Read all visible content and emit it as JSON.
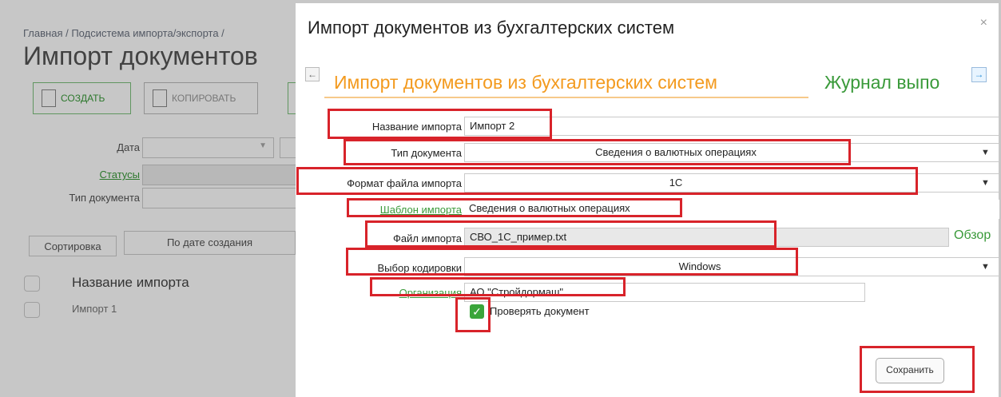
{
  "background": {
    "breadcrumb": "Главная  /  Подсистема импорта/экспорта  /",
    "page_title": "Импорт документов",
    "buttons": {
      "create": "СОЗДАТЬ",
      "copy": "КОПИРОВАТЬ"
    },
    "filters": {
      "date_label": "Дата",
      "statuses_label": "Статусы",
      "doc_type_label": "Тип документа",
      "sort_label": "Сортировка",
      "sort_value": "По дате создания"
    },
    "list": {
      "header": "Название импорта",
      "rows": [
        "Импорт 1"
      ]
    }
  },
  "dialog": {
    "title": "Импорт документов из бухгалтерских систем",
    "close_glyph": "×",
    "tabs": [
      "Импорт документов из бухгалтерских систем",
      "Журнал выпо"
    ],
    "fields": {
      "import_name": {
        "label": "Название импорта",
        "value": "Импорт 2"
      },
      "doc_type": {
        "label": "Тип документа",
        "value": "Сведения о валютных операциях"
      },
      "file_format": {
        "label": "Формат файла импорта",
        "value": "1C"
      },
      "template": {
        "label": "Шаблон импорта",
        "value": "Сведения о валютных операциях"
      },
      "import_file": {
        "label": "Файл импорта",
        "value": "СВО_1С_пример.txt",
        "browse": "Обзор"
      },
      "encoding": {
        "label": "Выбор кодировки",
        "value": "Windows"
      },
      "organization": {
        "label": "Организация",
        "value": "АО \"Стройдормаш\""
      }
    },
    "check_document": {
      "label": "Проверять документ",
      "checked": true
    },
    "save_label": "Сохранить"
  },
  "colors": {
    "accent_orange": "#f39a1e",
    "accent_green": "#3a9a3a",
    "highlight_red": "#d8232a"
  }
}
